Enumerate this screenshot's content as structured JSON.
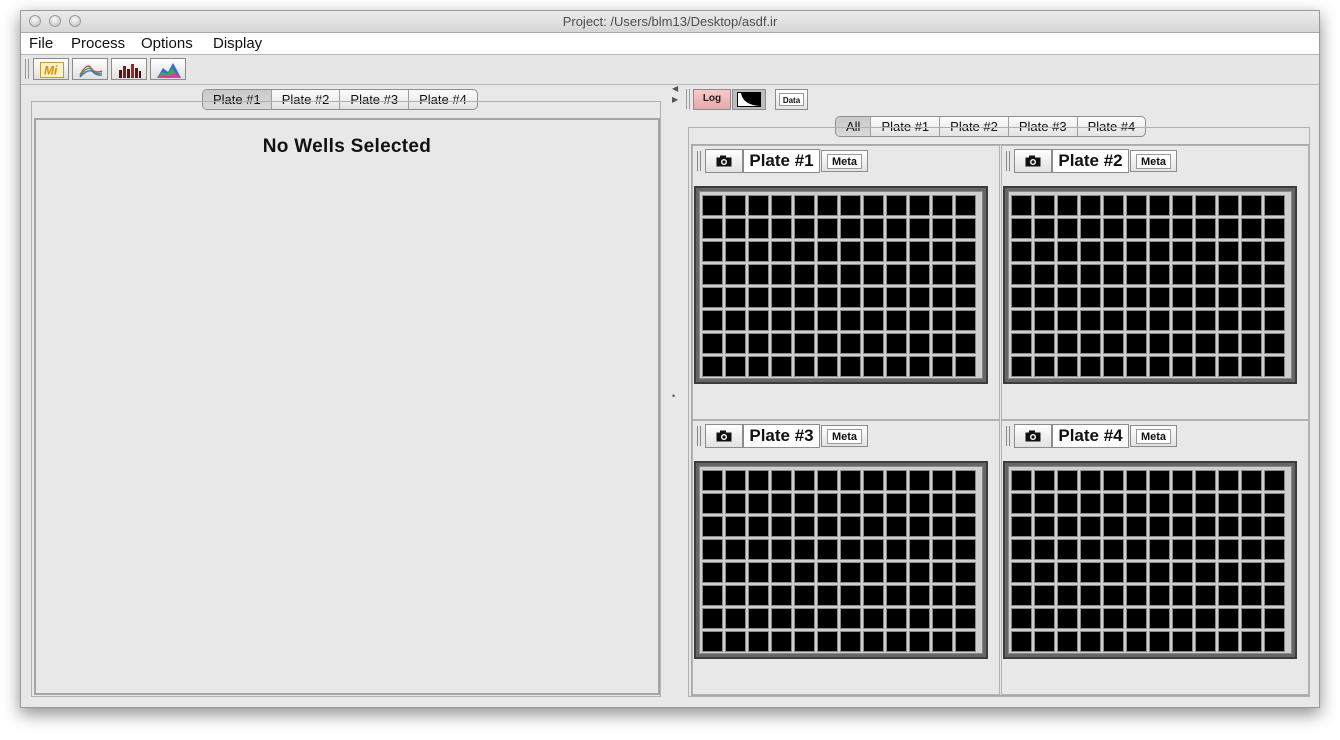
{
  "window": {
    "title": "Project: /Users/blm13/Desktop/asdf.ir"
  },
  "menu": [
    "File",
    "Process",
    "Options",
    "Display"
  ],
  "toolbar": {
    "icons": [
      "mi-icon",
      "spectrum-curves-icon",
      "bar-histogram-icon",
      "area-spectrum-icon"
    ],
    "mi_text": "Mi"
  },
  "left_tabs": [
    "Plate #1",
    "Plate #2",
    "Plate #3",
    "Plate #4"
  ],
  "left_selected": "Plate #1",
  "left_panel": {
    "message": "No Wells Selected"
  },
  "right_toolbar": {
    "log_label": "Log",
    "data_label": "Data"
  },
  "right_tabs": [
    "All",
    "Plate #1",
    "Plate #2",
    "Plate #3",
    "Plate #4"
  ],
  "right_selected": "All",
  "plates": [
    {
      "title": "Plate #1",
      "meta_label": "Meta"
    },
    {
      "title": "Plate #2",
      "meta_label": "Meta"
    },
    {
      "title": "Plate #3",
      "meta_label": "Meta"
    },
    {
      "title": "Plate #4",
      "meta_label": "Meta"
    }
  ],
  "plate_layout": {
    "rows": 8,
    "cols": 12
  },
  "colors": {
    "well": "#000000",
    "log_button": "#f0b8b8",
    "window_bg": "#e8e8e8"
  }
}
